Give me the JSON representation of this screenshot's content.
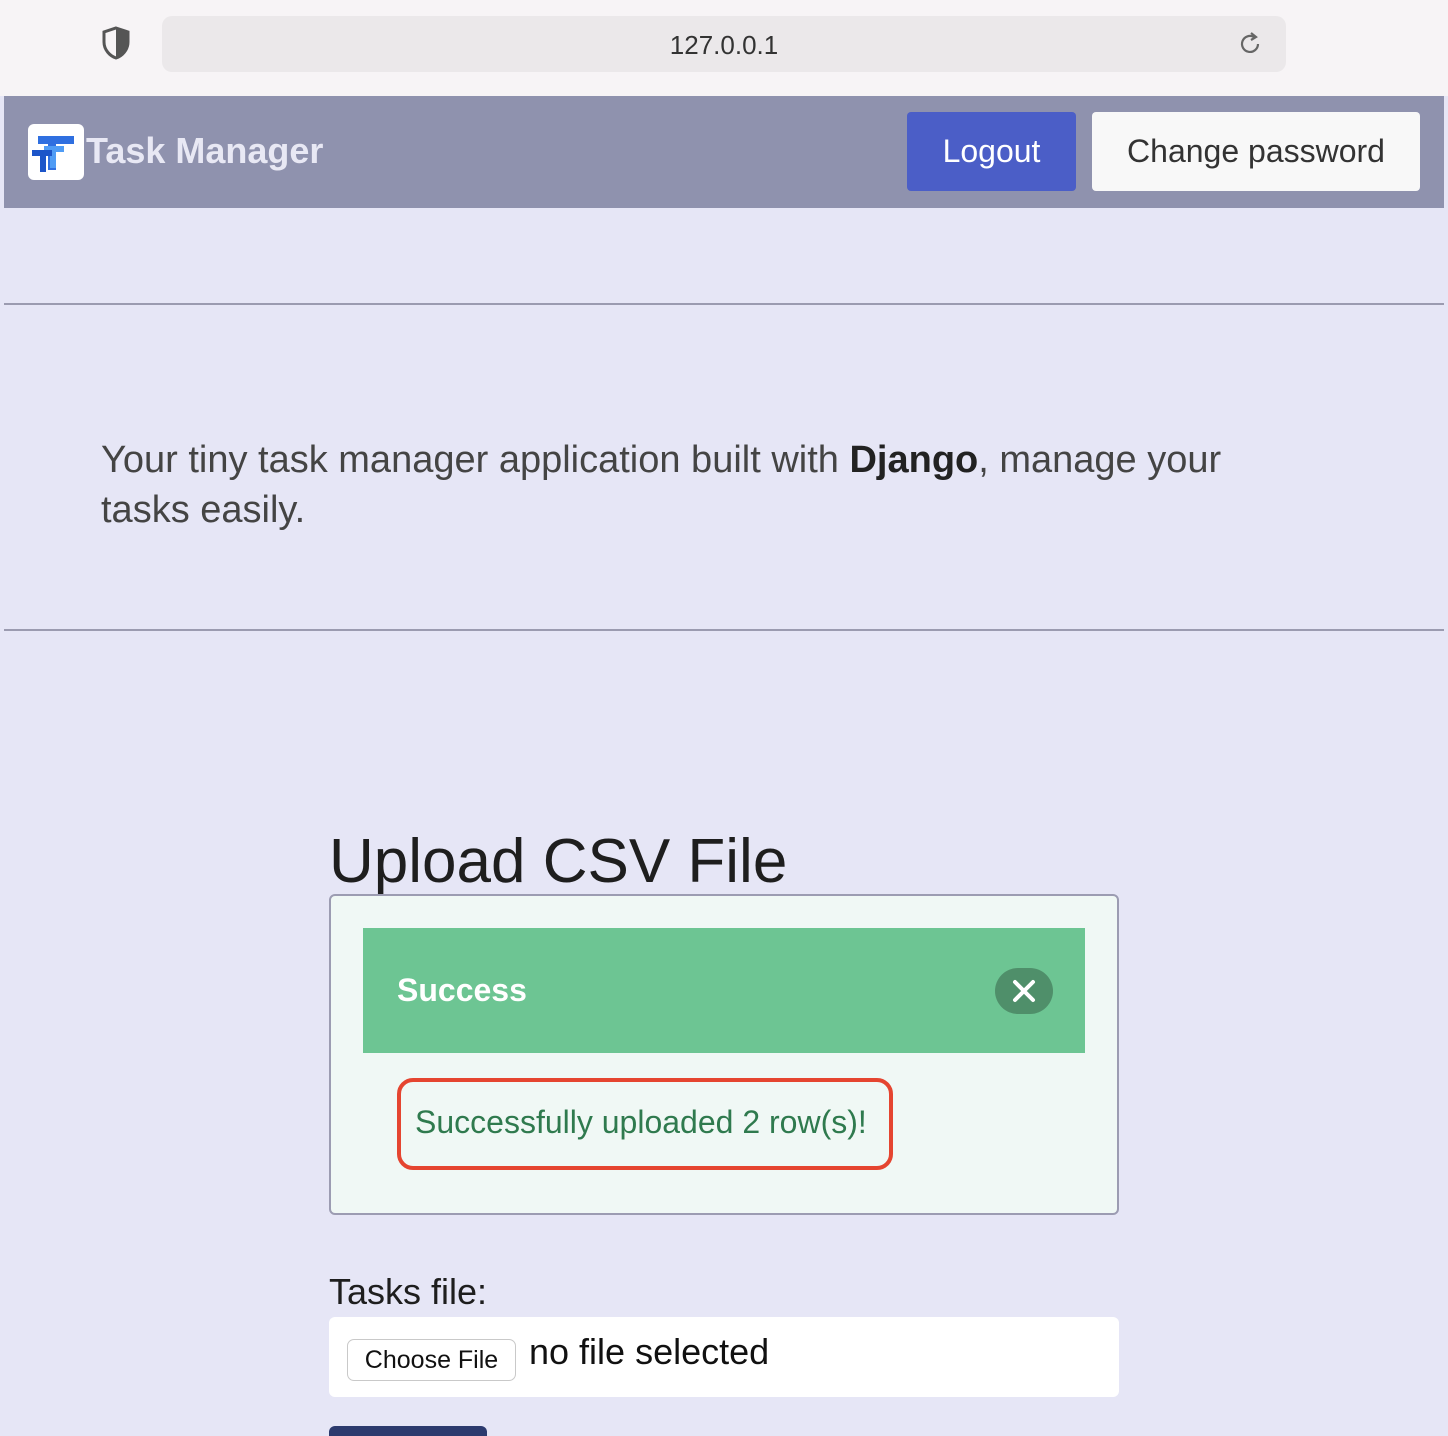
{
  "browser": {
    "url": "127.0.0.1",
    "shield_icon": "shield-icon",
    "reload_icon": "reload-icon"
  },
  "navbar": {
    "brand": "Task Manager",
    "logo_icon": "task-manager-logo",
    "logout_label": "Logout",
    "change_password_label": "Change password",
    "bg_color": "#8f92ae",
    "logout_color": "#4b5ec7"
  },
  "hero": {
    "tagline_before": "Your tiny task manager application built with ",
    "tagline_bold": "Django",
    "tagline_after": ", manage your tasks easily."
  },
  "upload": {
    "title": "Upload CSV File",
    "alert": {
      "title": "Success",
      "message": "Successfully uploaded 2 row(s)!",
      "close_icon": "close-icon",
      "color": "#6dc593"
    },
    "file_label": "Tasks file:",
    "choose_file_label": "Choose File",
    "no_file_text": "no file selected"
  }
}
